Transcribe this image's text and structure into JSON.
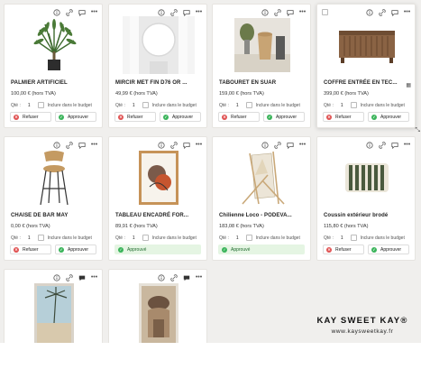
{
  "labels": {
    "qty": "Qté :",
    "include_budget": "Inclure dans le budget",
    "refuse": "Refuser",
    "approve": "Approuver",
    "approved": "Approuvé"
  },
  "cards": [
    {
      "title": "PALMIER ARTIFICIEL",
      "price": "100,00 € (hors TVA)",
      "qty": "1",
      "status": "pending"
    },
    {
      "title": "MIRCIR MET FIN D76 OR ...",
      "price": "49,99 € (hors TVA)",
      "qty": "1",
      "status": "pending"
    },
    {
      "title": "TABOURET EN SUAR",
      "price": "159,00 € (hors TVA)",
      "qty": "1",
      "status": "pending"
    },
    {
      "title": "COFFRE ENTRÉE EN TEC...",
      "price": "399,00 € (hors TVA)",
      "qty": "1",
      "status": "pending"
    },
    {
      "title": "CHAISE DE BAR MAY",
      "price": "0,00 € (hors TVA)",
      "qty": "1",
      "status": "pending"
    },
    {
      "title": "TABLEAU ENCADRÉ FOR...",
      "price": "89,91 € (hors TVA)",
      "qty": "1",
      "status": "approved"
    },
    {
      "title": "Chilienne Loco - PODEVA...",
      "price": "183,08 € (hors TVA)",
      "qty": "1",
      "status": "approved"
    },
    {
      "title": "Coussin extérieur brodé",
      "price": "115,80 € (hors TVA)",
      "qty": "1",
      "status": "pending"
    },
    {
      "title": "",
      "price": "",
      "qty": "",
      "status": "none"
    },
    {
      "title": "",
      "price": "",
      "qty": "",
      "status": "none"
    }
  ],
  "brand": {
    "name": "KAY SWEET KAY®",
    "url": "www.kaysweetkay.fr"
  },
  "colors": {
    "refuse": "#e05252",
    "approve": "#3bb45b",
    "approved_bg": "#e5f5e3"
  }
}
